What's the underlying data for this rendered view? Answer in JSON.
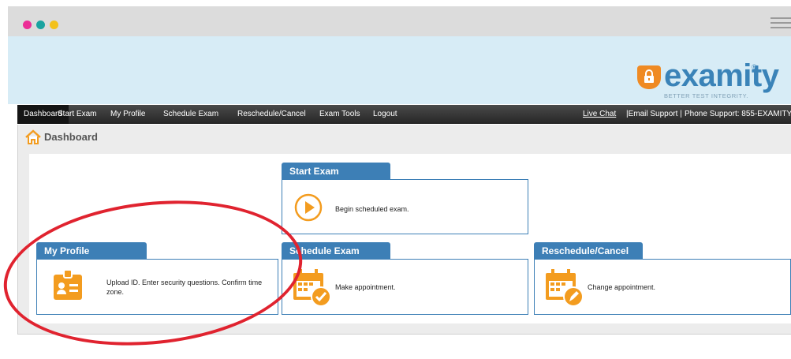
{
  "window": {
    "traffic_lights": [
      "#ec2d96",
      "#1aa3a0",
      "#f3c11b"
    ],
    "menu_icon": "hamburger-icon"
  },
  "brand": {
    "name": "examity",
    "tagline": "BETTER TEST INTEGRITY.",
    "registered": "®",
    "accent": "#3a83b8",
    "shield_color": "#ef8a23"
  },
  "nav": {
    "items": [
      "Dashboard",
      "Start Exam",
      "My Profile",
      "Schedule Exam",
      "Reschedule/Cancel",
      "Exam Tools",
      "Logout"
    ],
    "live_chat": "Live Chat",
    "email_support": "|Email Support |",
    "phone_support": "Phone Support: 855-EXAMITY"
  },
  "page": {
    "title": "Dashboard"
  },
  "cards": {
    "start_exam": {
      "title": "Start Exam",
      "text": "Begin scheduled exam.",
      "icon": "play-icon"
    },
    "my_profile": {
      "title": "My Profile",
      "text": "Upload ID. Enter security questions. Confirm time zone.",
      "icon": "id-card-icon"
    },
    "schedule_exam": {
      "title": "Schedule Exam",
      "text": "Make appointment.",
      "icon": "calendar-check-icon"
    },
    "reschedule_cancel": {
      "title": "Reschedule/Cancel",
      "text": "Change appointment.",
      "icon": "calendar-edit-icon"
    }
  },
  "colors": {
    "nav_bg": "#333333",
    "card_blue": "#3d7fb6",
    "icon_orange": "#f39c1f",
    "highlight_red": "#e0232f"
  }
}
